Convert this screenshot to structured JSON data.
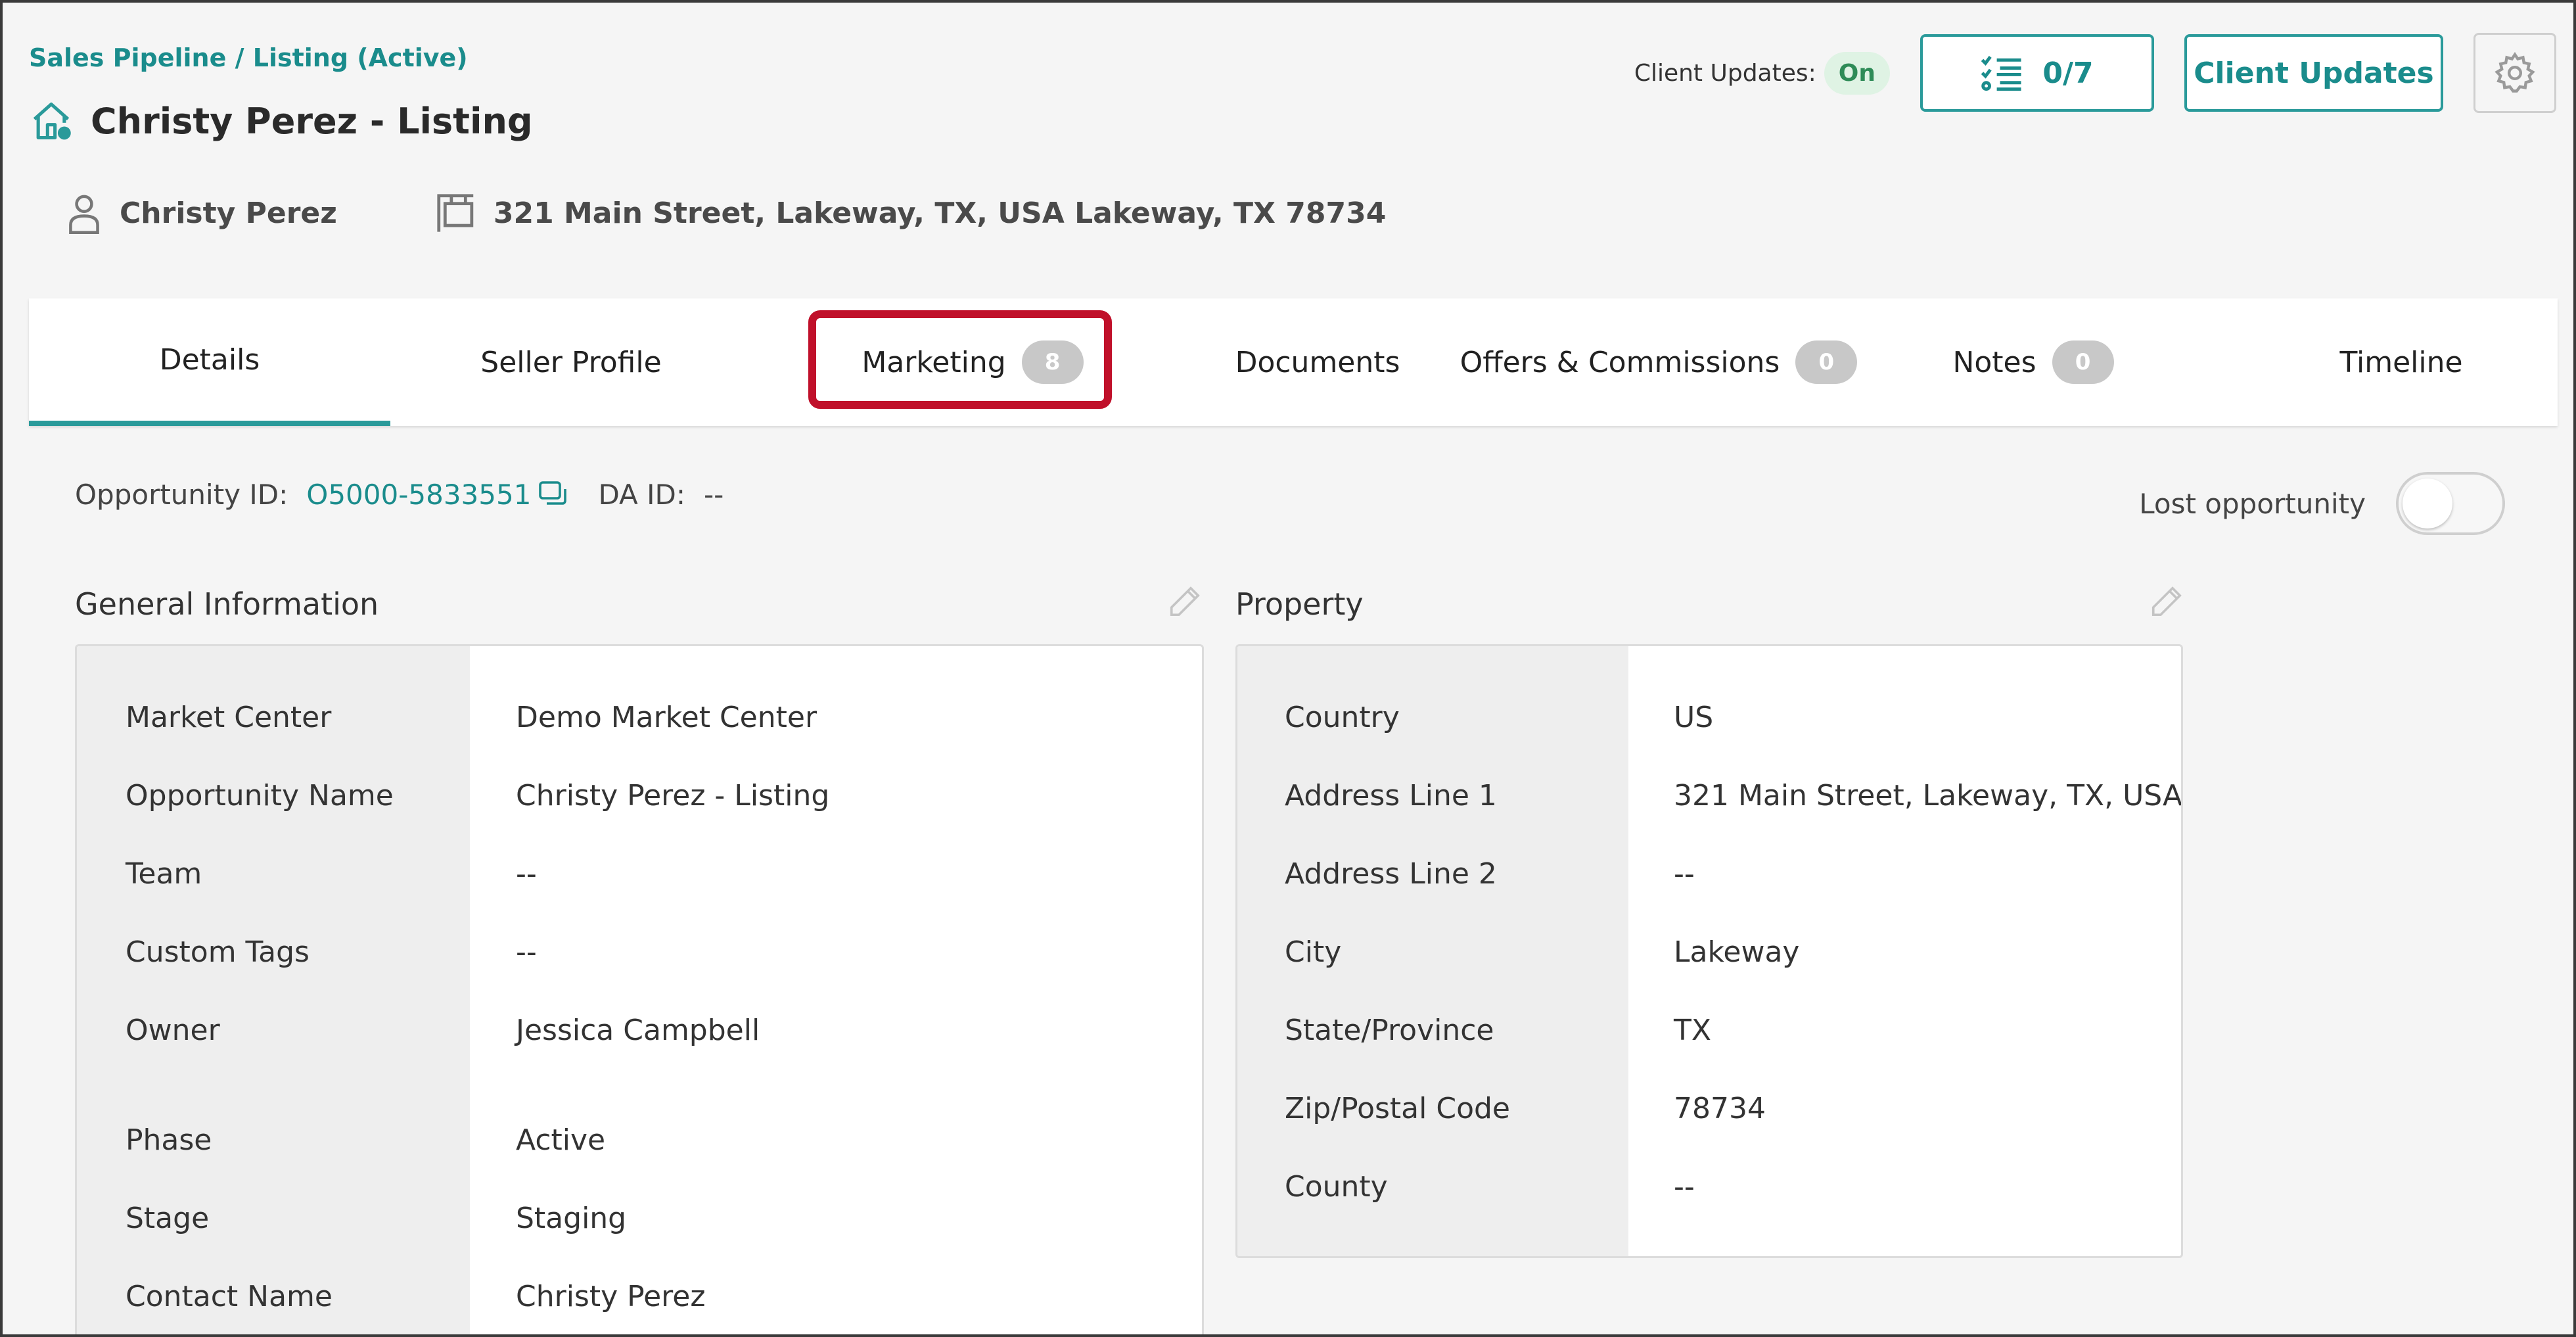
{
  "breadcrumb": {
    "pipeline": "Sales Pipeline",
    "separator": " / ",
    "current": "Listing (Active)"
  },
  "header": {
    "title": "Christy Perez - Listing",
    "client_updates_label": "Client Updates:",
    "client_updates_status": "On",
    "tasks_progress": "0/7",
    "client_updates_button": "Client Updates"
  },
  "meta": {
    "contact_name": "Christy Perez",
    "address": "321 Main Street, Lakeway, TX, USA Lakeway, TX 78734"
  },
  "tabs": [
    {
      "label": "Details",
      "active": true
    },
    {
      "label": "Seller Profile"
    },
    {
      "label": "Marketing",
      "count": "8"
    },
    {
      "label": "Documents"
    },
    {
      "label": "Offers & Commissions",
      "count": "0"
    },
    {
      "label": "Notes",
      "count": "0"
    },
    {
      "label": "Timeline"
    }
  ],
  "opportunity": {
    "id_label": "Opportunity ID:",
    "id_value": "O5000-5833551",
    "da_label": "DA ID:",
    "da_value": "--",
    "lost_label": "Lost opportunity",
    "lost_enabled": false
  },
  "general_information": {
    "title": "General Information",
    "rows": [
      {
        "label": "Market Center",
        "value": "Demo Market Center"
      },
      {
        "label": "Opportunity Name",
        "value": "Christy Perez - Listing"
      },
      {
        "label": "Team",
        "value": "--"
      },
      {
        "label": "Custom Tags",
        "value": "--"
      },
      {
        "label": "Owner",
        "value": "Jessica Campbell"
      },
      {
        "label": "Phase",
        "value": "Active"
      },
      {
        "label": "Stage",
        "value": "Staging"
      },
      {
        "label": "Contact Name",
        "value": "Christy Perez"
      }
    ]
  },
  "property": {
    "title": "Property",
    "rows": [
      {
        "label": "Country",
        "value": "US"
      },
      {
        "label": "Address Line 1",
        "value": "321 Main Street, Lakeway, TX, USA"
      },
      {
        "label": "Address Line 2",
        "value": "--"
      },
      {
        "label": "City",
        "value": "Lakeway"
      },
      {
        "label": "State/Province",
        "value": "TX"
      },
      {
        "label": "Zip/Postal Code",
        "value": "78734"
      },
      {
        "label": "County",
        "value": "--"
      }
    ]
  },
  "colors": {
    "accent": "#2a9a9a",
    "highlight": "#c0102a",
    "status_on_bg": "#dff3e4"
  }
}
